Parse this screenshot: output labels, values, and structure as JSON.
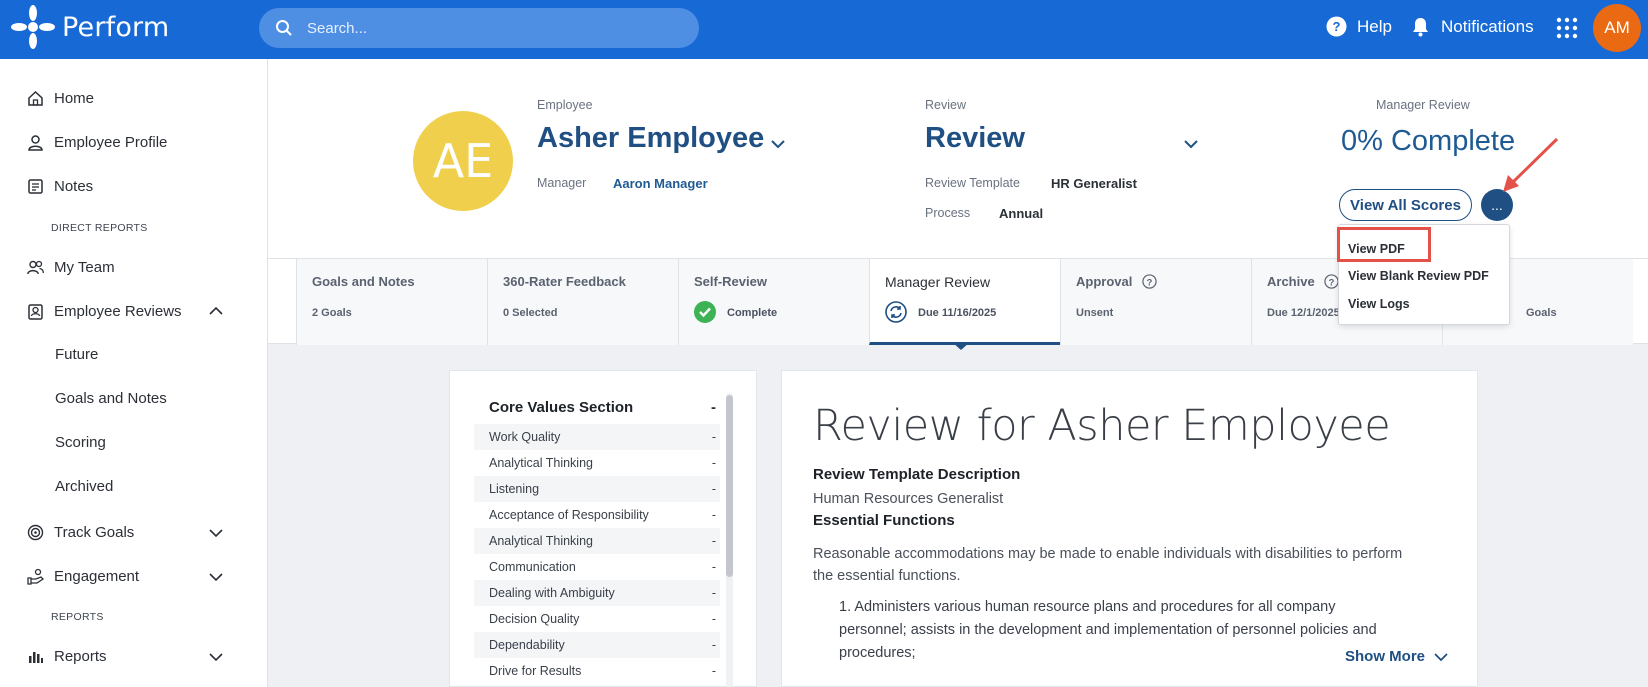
{
  "topbar": {
    "app_name": "Perform",
    "search_placeholder": "Search...",
    "help_label": "Help",
    "notifications_label": "Notifications",
    "user_initials": "AM",
    "colors": {
      "bar": "#1769d6",
      "avatar": "#ea6a13"
    }
  },
  "sidebar": {
    "home": "Home",
    "employee_profile": "Employee Profile",
    "notes": "Notes",
    "direct_reports_heading": "DIRECT REPORTS",
    "my_team": "My Team",
    "employee_reviews": "Employee Reviews",
    "sub_future": "Future",
    "sub_goals_notes": "Goals and Notes",
    "sub_scoring": "Scoring",
    "sub_archived": "Archived",
    "track_goals": "Track Goals",
    "engagement": "Engagement",
    "reports_heading": "REPORTS",
    "reports": "Reports"
  },
  "header": {
    "employee_initials": "AE",
    "employee_label": "Employee",
    "employee_name": "Asher Employee",
    "manager_label": "Manager",
    "manager_name": "Aaron Manager",
    "review_label": "Review",
    "review_title": "Review",
    "review_template_label": "Review Template",
    "review_template_value": "HR Generalist",
    "process_label": "Process",
    "process_value": "Annual",
    "manager_review_label": "Manager Review",
    "percent_complete": "0% Complete",
    "view_all_scores": "View All Scores",
    "more_button": "..."
  },
  "menu": {
    "items": [
      "View PDF",
      "View Blank Review PDF",
      "View Logs"
    ]
  },
  "tabs": [
    {
      "title": "Goals and Notes",
      "sub": "2 Goals"
    },
    {
      "title": "360-Rater Feedback",
      "sub": "0 Selected"
    },
    {
      "title": "Self-Review",
      "sub": "Complete"
    },
    {
      "title": "Manager Review",
      "sub": "Due 11/16/2025"
    },
    {
      "title": "Approval",
      "sub": "Unsent"
    },
    {
      "title": "Archive",
      "sub": "Due 12/1/2025"
    },
    {
      "title": "",
      "sub": "Goals"
    }
  ],
  "core_values": {
    "title": "Core Values Section",
    "dash": "-",
    "items": [
      "Work Quality",
      "Analytical Thinking",
      "Listening",
      "Acceptance of Responsibility",
      "Analytical Thinking",
      "Communication",
      "Dealing with Ambiguity",
      "Decision Quality",
      "Dependability",
      "Drive for Results"
    ]
  },
  "document": {
    "title": "Review for Asher Employee",
    "template_desc_heading": "Review Template Description",
    "template_desc": "Human Resources Generalist",
    "essential_heading": "Essential Functions",
    "accommodation_text": "Reasonable accommodations may be made to enable individuals with disabilities to perform the essential functions.",
    "list_item_1": "1. Administers various human resource plans and procedures for all company personnel; assists in the development and implementation of personnel policies and procedures;",
    "show_more": "Show More"
  }
}
